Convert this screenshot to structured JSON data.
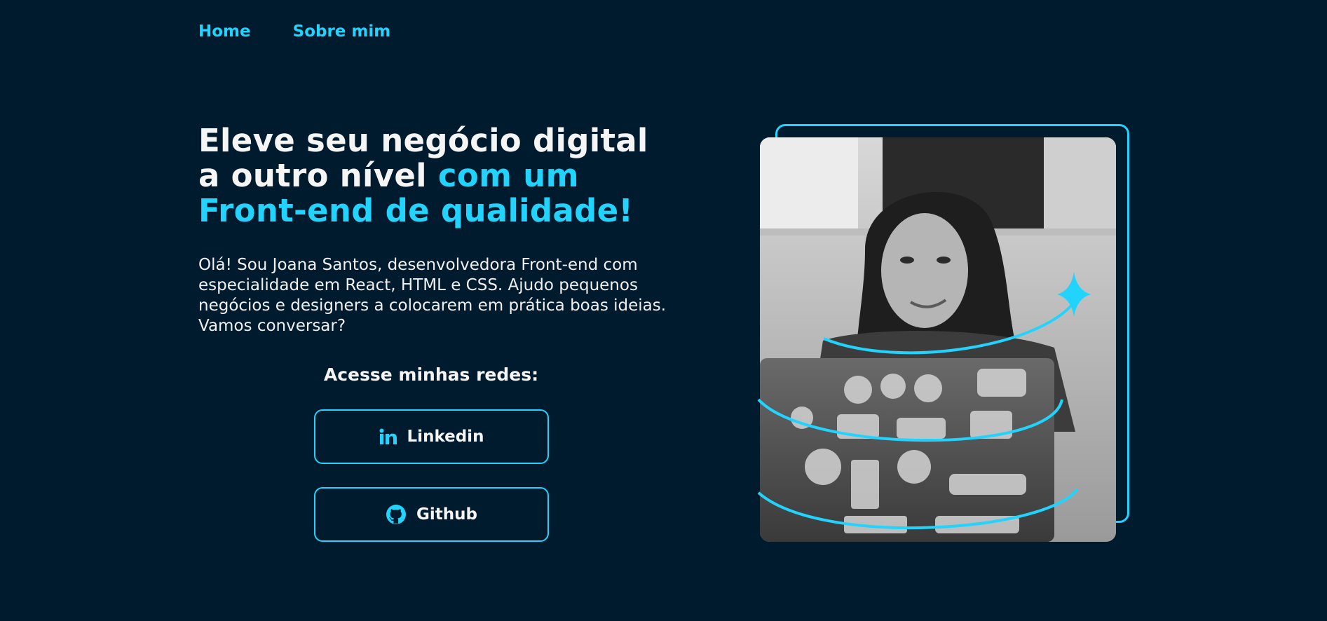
{
  "nav": {
    "items": [
      {
        "label": "Home"
      },
      {
        "label": "Sobre mim"
      }
    ]
  },
  "hero": {
    "headline_part1": "Eleve seu negócio digital a outro nível ",
    "headline_accent": "com um Front-end de qualidade!",
    "bio": "Olá! Sou Joana Santos, desenvolvedora Front-end com especialidade em React, HTML e CSS. Ajudo pequenos negócios e designers a colocarem em prática boas ideias. Vamos conversar?"
  },
  "social": {
    "title": "Acesse minhas redes:",
    "buttons": [
      {
        "label": "Linkedin",
        "icon": "linkedin-icon"
      },
      {
        "label": "Github",
        "icon": "github-icon"
      }
    ]
  },
  "colors": {
    "background": "#001a2e",
    "accent": "#22d4fd",
    "text": "#f5f5f5"
  }
}
